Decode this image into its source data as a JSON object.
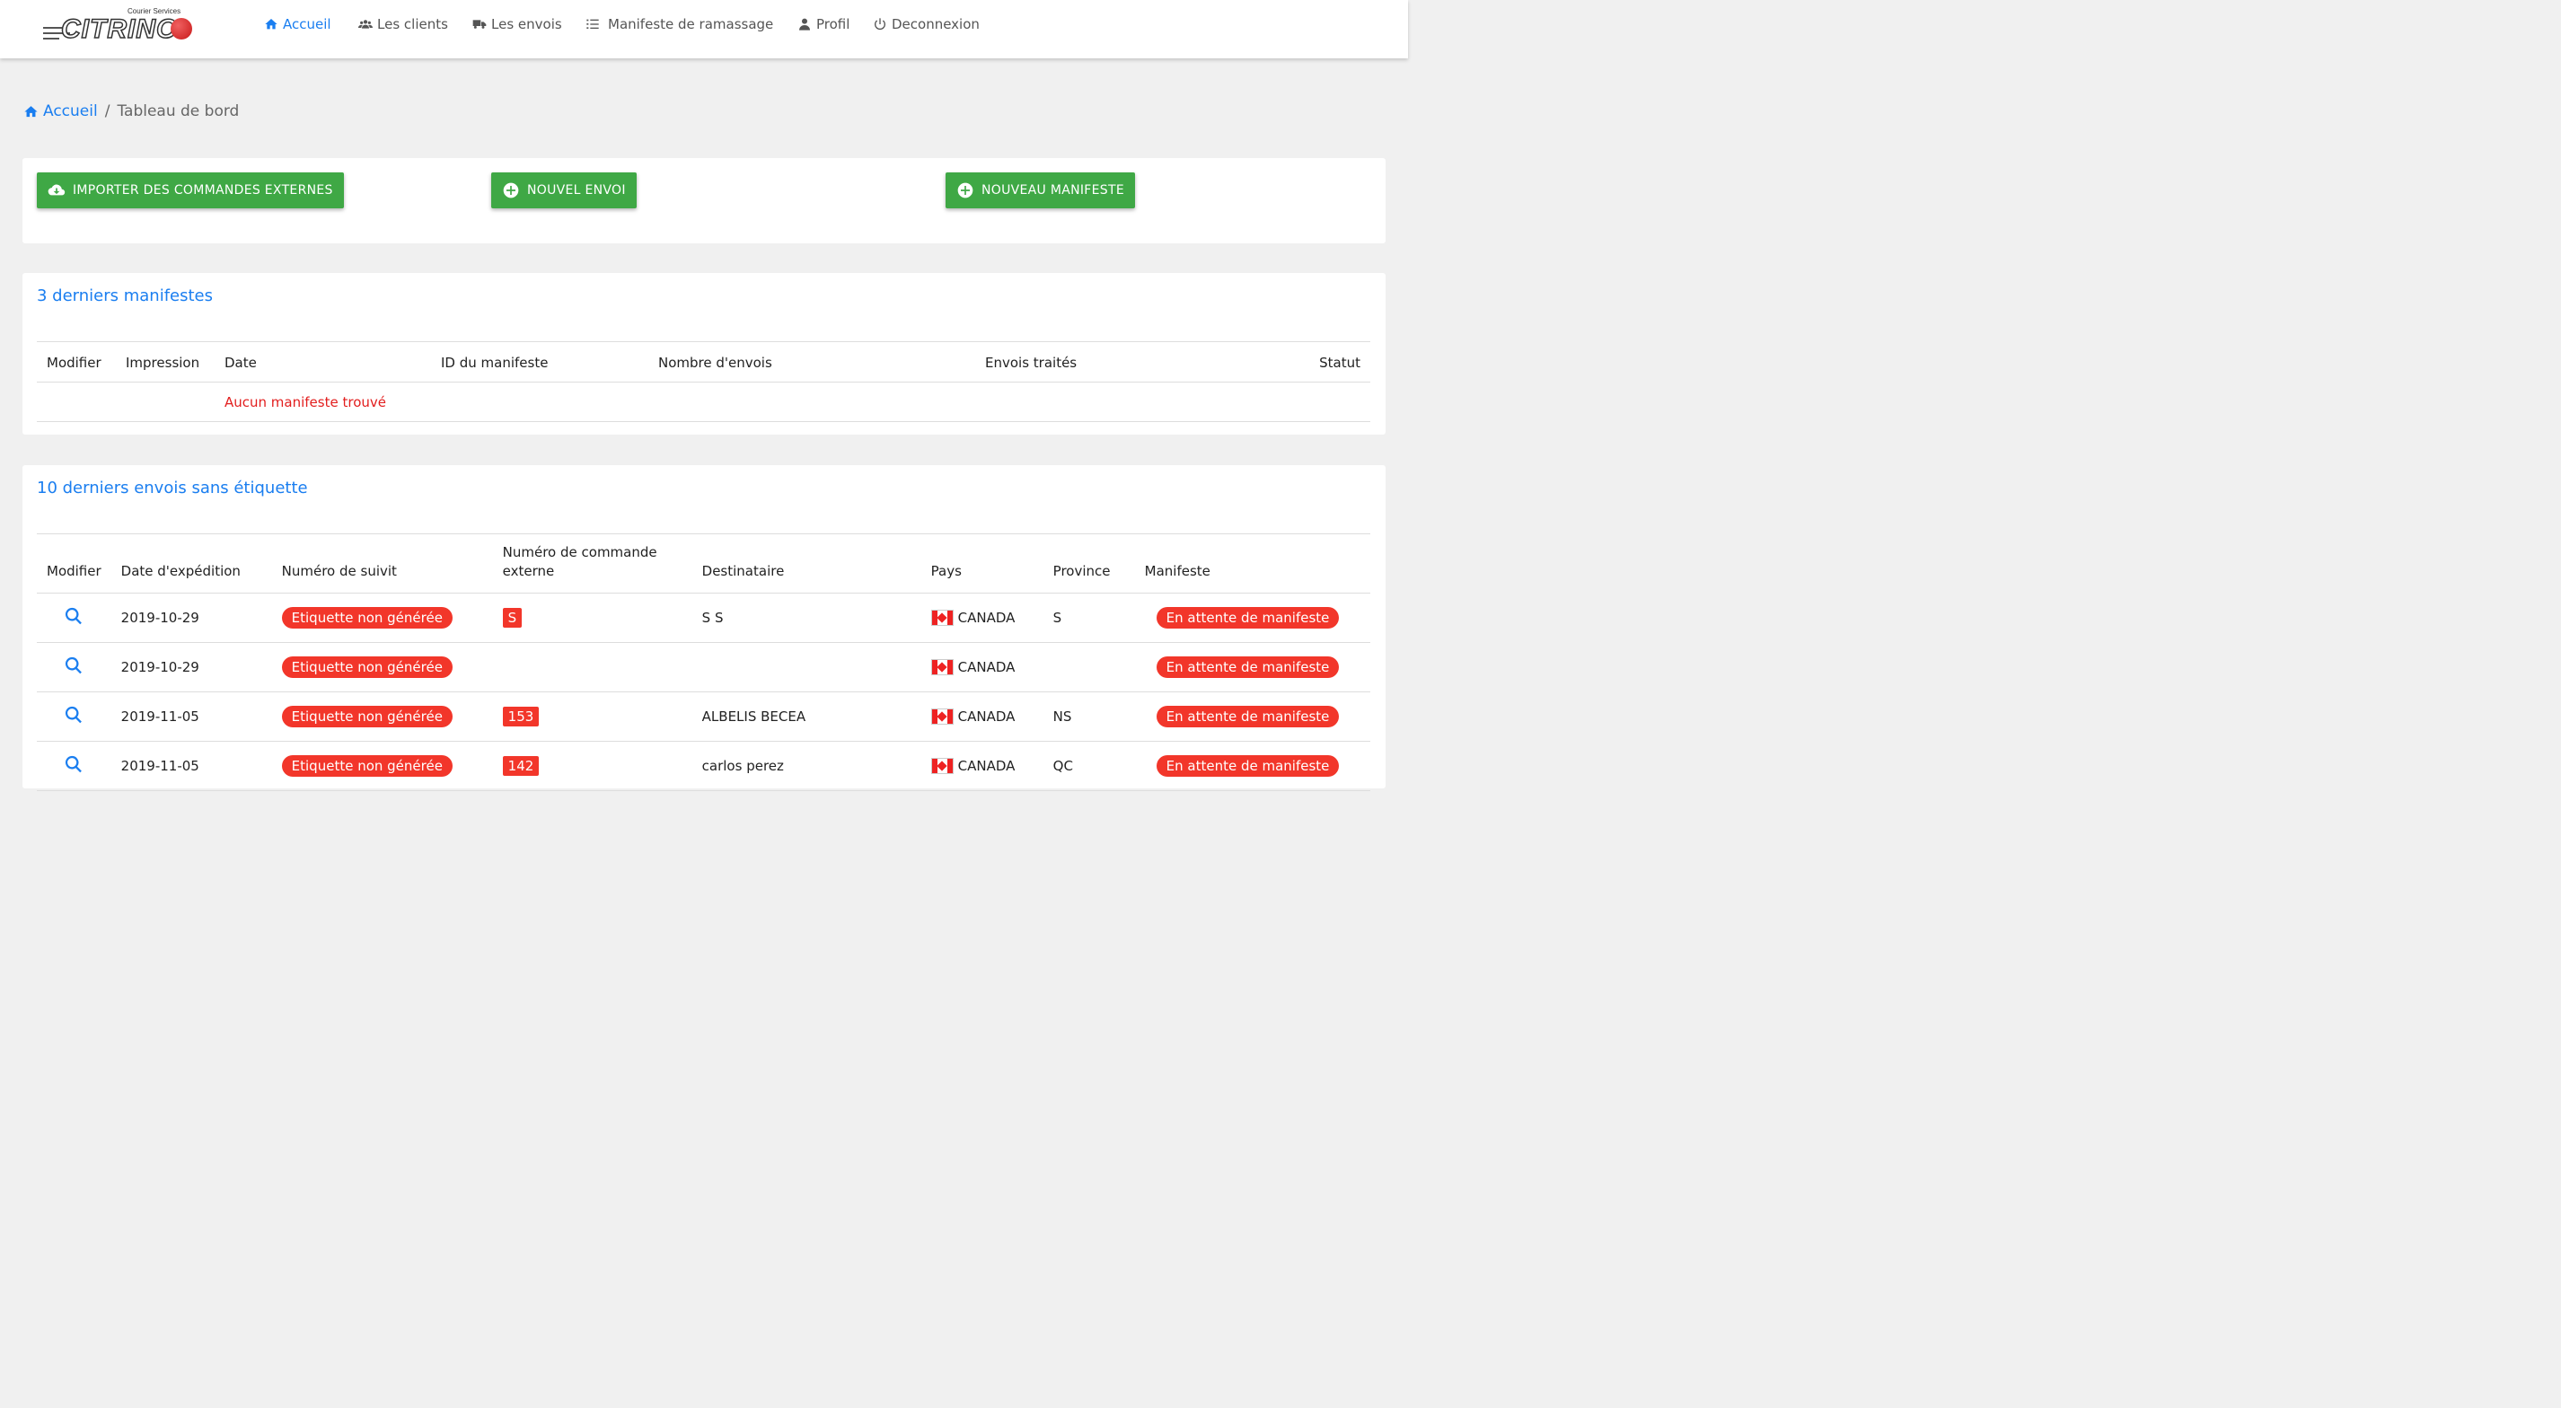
{
  "brand": {
    "tagline": "Courier Services",
    "name": "CITRINO"
  },
  "nav": {
    "items": [
      {
        "label": "Accueil",
        "icon": "home-icon",
        "active": true
      },
      {
        "label": "Les clients",
        "icon": "users-icon"
      },
      {
        "label": "Les envois",
        "icon": "truck-icon"
      },
      {
        "label": "Manifeste de ramassage",
        "icon": "list-icon"
      },
      {
        "label": "Profil",
        "icon": "user-icon"
      },
      {
        "label": "Deconnexion",
        "icon": "power-icon"
      }
    ]
  },
  "breadcrumb": {
    "home": "Accueil",
    "separator": "/",
    "current": "Tableau de bord"
  },
  "actions": {
    "import_label": "IMPORTER DES COMMANDES EXTERNES",
    "new_shipment_label": "NOUVEL ENVOI",
    "new_manifest_label": "NOUVEAU MANIFESTE"
  },
  "manifests": {
    "title": "3 derniers manifestes",
    "columns": [
      "Modifier",
      "Impression",
      "Date",
      "ID du manifeste",
      "Nombre d'envois",
      "Envois traités",
      "Statut"
    ],
    "empty_message": "Aucun manifeste trouvé"
  },
  "shipments": {
    "title": "10 derniers envois sans étiquette",
    "columns": [
      "Modifier",
      "Date d'expédition",
      "Numéro de suivit",
      "Numéro de commande externe",
      "Destinataire",
      "Pays",
      "Province",
      "Manifeste"
    ],
    "rows": [
      {
        "date": "2019-10-29",
        "tracking": "Etiquette non générée",
        "order": "S",
        "recipient": "S S",
        "country": "CANADA",
        "province": "S",
        "manifest": "En attente de manifeste"
      },
      {
        "date": "2019-10-29",
        "tracking": "Etiquette non générée",
        "order": "",
        "recipient": "",
        "country": "CANADA",
        "province": "",
        "manifest": "En attente de manifeste"
      },
      {
        "date": "2019-11-05",
        "tracking": "Etiquette non générée",
        "order": "153",
        "recipient": "ALBELIS BECEA",
        "country": "CANADA",
        "province": "NS",
        "manifest": "En attente de manifeste"
      },
      {
        "date": "2019-11-05",
        "tracking": "Etiquette non générée",
        "order": "142",
        "recipient": "carlos perez",
        "country": "CANADA",
        "province": "QC",
        "manifest": "En attente de manifeste"
      }
    ]
  },
  "colors": {
    "accent": "#1a7ef0",
    "success": "#3fa845",
    "danger": "#f2362a"
  }
}
